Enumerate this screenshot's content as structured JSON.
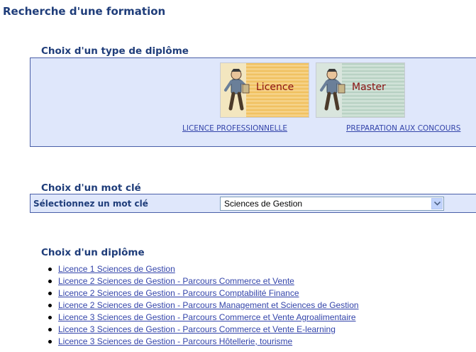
{
  "page": {
    "title": "Recherche d'une formation"
  },
  "type_section": {
    "title": "Choix d'un type de diplôme",
    "licence_image_label": "Licence",
    "master_image_label": "Master",
    "links": [
      "LICENCE PROFESSIONNELLE",
      "PREPARATION AUX CONCOURS"
    ]
  },
  "keyword_section": {
    "title": "Choix d'un mot clé",
    "label": "Sélectionnez un mot clé",
    "selected_value": "Sciences de Gestion"
  },
  "diploma_section": {
    "title": "Choix d'un diplôme",
    "items": [
      "Licence 1 Sciences de Gestion",
      "Licence 2 Sciences de Gestion - Parcours Commerce et Vente",
      "Licence 2 Sciences de Gestion - Parcours Comptabilité Finance",
      "Licence 2 Sciences de Gestion - Parcours Management et Sciences de Gestion",
      "Licence 3 Sciences de Gestion - Parcours Commerce et Vente Agroalimentaire",
      "Licence 3 Sciences de Gestion - Parcours Commerce et Vente E-learning",
      "Licence 3 Sciences de Gestion - Parcours Hôtellerie, tourisme"
    ]
  },
  "colors": {
    "heading": "#1f3d7a",
    "panel_bg": "#dfe7fb",
    "panel_border": "#4a5fa8",
    "link": "#3344aa"
  },
  "icons": {
    "licence_figure": "cartoon-student-icon",
    "master_figure": "cartoon-student-icon",
    "select_arrow": "chevron-down-icon"
  }
}
